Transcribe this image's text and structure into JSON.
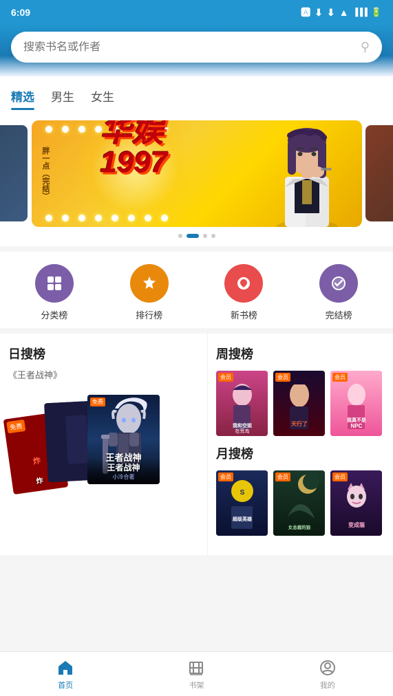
{
  "statusBar": {
    "time": "6:09",
    "icons": [
      "notification",
      "download",
      "download2",
      "wifi",
      "signal",
      "battery"
    ]
  },
  "search": {
    "placeholder": "搜索书名或作者"
  },
  "tabs": [
    {
      "label": "精选",
      "active": true
    },
    {
      "label": "男生",
      "active": false
    },
    {
      "label": "女生",
      "active": false
    }
  ],
  "banner": {
    "title": "华娱",
    "year": "1997",
    "leftLabel": "胖一点（完结）",
    "dots": [
      false,
      true,
      false,
      false
    ]
  },
  "categories": [
    {
      "id": "classify",
      "label": "分类榜",
      "color": "purple",
      "icon": "⊞"
    },
    {
      "id": "rank",
      "label": "排行榜",
      "color": "orange",
      "icon": "♛"
    },
    {
      "id": "new",
      "label": "新书榜",
      "color": "red",
      "icon": "♥"
    },
    {
      "id": "complete",
      "label": "完结榜",
      "color": "violet",
      "icon": "✓"
    }
  ],
  "dailySearch": {
    "title": "日搜榜",
    "topBook": "《王者战神》",
    "badge": "免费"
  },
  "weeklySearch": {
    "title": "周搜榜",
    "books": [
      {
        "title": "我和空姐在荒岛",
        "badge": "会员"
      },
      {
        "title": "天行了",
        "badge": "会员"
      },
      {
        "title": "我真不是NPC",
        "badge": "会员"
      }
    ]
  },
  "monthlySearch": {
    "title": "月搜榜",
    "books": [
      {
        "title": "超级英雄",
        "badge": "会员"
      },
      {
        "title": "女总裁的狼",
        "badge": "会员"
      },
      {
        "title": "变成猫",
        "badge": "会员"
      }
    ]
  },
  "bottomNav": [
    {
      "label": "首页",
      "active": true,
      "icon": "home"
    },
    {
      "label": "书架",
      "active": false,
      "icon": "shelf"
    },
    {
      "label": "我的",
      "active": false,
      "icon": "profile"
    }
  ]
}
